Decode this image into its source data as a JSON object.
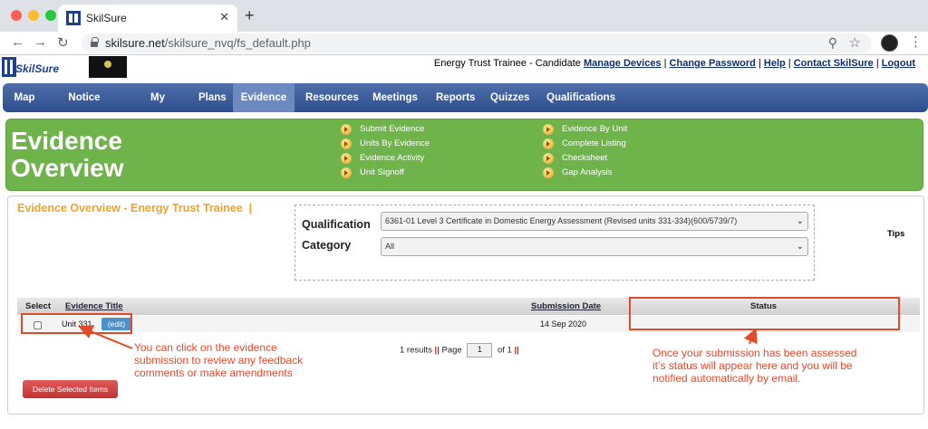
{
  "browser": {
    "tab_title": "SkilSure",
    "tab_close": "✕",
    "new_tab": "+",
    "url_host": "skilsure.net",
    "url_path": "/skilsure_nvq/fs_default.php"
  },
  "header": {
    "logo_text": "SkilSure",
    "user_text": "Energy Trust Trainee - Candidate",
    "links": [
      "Manage Devices",
      "Change Password",
      "Help",
      "Contact SkilSure",
      "Logout"
    ],
    "separator": "|"
  },
  "nav": {
    "items": [
      "Map",
      "Notice Board",
      "My Status",
      "Plans",
      "Evidence",
      "Resources",
      "Meetings",
      "Reports",
      "Quizzes",
      "Qualifications"
    ],
    "active": "Evidence"
  },
  "banner": {
    "title_line1": "Evidence",
    "title_line2": "Overview",
    "links_col1": [
      "Submit Evidence",
      "Units By Evidence",
      "Evidence Activity",
      "Unit Signoff"
    ],
    "links_col2": [
      "Evidence By Unit",
      "Complete Listing",
      "Checksheet",
      "Gap Analysis"
    ]
  },
  "content": {
    "heading": "Evidence Overview - Energy Trust Trainee",
    "heading_sep": "|",
    "filters": {
      "qualification_label": "Qualification",
      "qualification_value": "6361-01 Level 3 Certificate in Domestic Energy Assessment (Revised units 331-334)(600/5739/7)",
      "category_label": "Category",
      "category_value": "All"
    },
    "tips": "Tips",
    "table": {
      "headers": {
        "select": "Select",
        "title": "Evidence Title",
        "date": "Submission Date",
        "status": "Status"
      },
      "rows": [
        {
          "title": "Unit 331",
          "edit": "(edit)",
          "date": "14 Sep 2020",
          "status": ""
        }
      ]
    },
    "pagination": {
      "results": "1 results",
      "sep": "||",
      "page_label": "Page",
      "page_value": "1",
      "of_label": "of 1"
    },
    "delete_button": "Delete Selected Items"
  },
  "annotations": {
    "note_left": [
      "You can click on the evidence",
      "submission to review any feedback",
      "comments or make amendments"
    ],
    "note_right": [
      "Once your submission has been assessed",
      "it’s status will appear here and you will be",
      "notified automatically by email."
    ],
    "color": "#e34a2a"
  },
  "colors": {
    "nav_bg": "#3b5c99",
    "banner_green": "#6fb34b",
    "heading_orange": "#f0a22d",
    "delete_red": "#c23333",
    "edit_blue": "#4c92c8"
  }
}
